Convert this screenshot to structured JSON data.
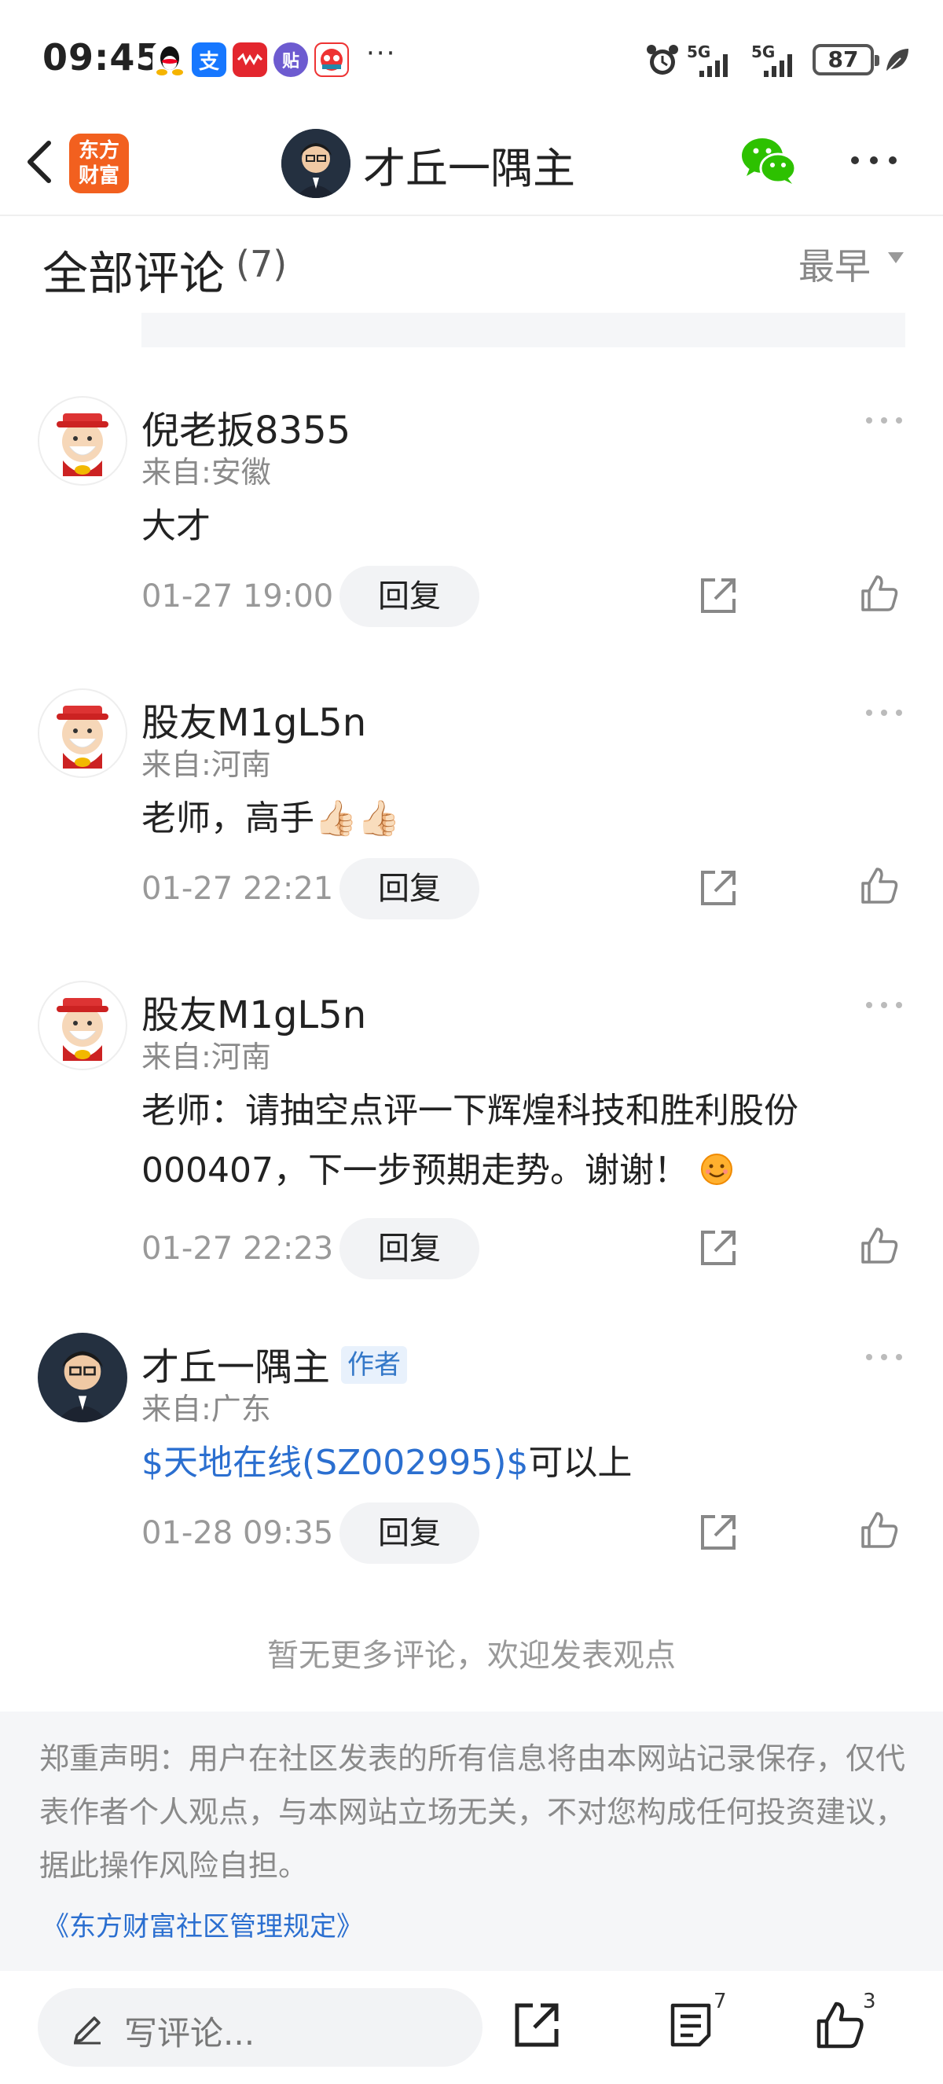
{
  "status_bar": {
    "time": "09:45",
    "app_icons": [
      "qq-icon",
      "alipay-icon",
      "music-icon",
      "tieba-icon",
      "game-icon"
    ],
    "alipay_glyph": "支",
    "tieba_glyph": "贴",
    "more": "···",
    "signal_1": "5G",
    "signal_2": "5G",
    "battery": "87"
  },
  "nav": {
    "brand": "东方财富",
    "brand_line1": "东方",
    "brand_line2": "财富",
    "title": "才丘一隅主"
  },
  "comments_header": {
    "title": "全部评论",
    "count": "(7)",
    "sort": "最早"
  },
  "comments": [
    {
      "name": "倪老扳8355",
      "location": "来自:安徽",
      "text": "大才",
      "time": "01-27 19:00",
      "reply": "回复"
    },
    {
      "name": "股友M1gL5n",
      "location": "来自:河南",
      "text": "老师，高手👍🏻👍🏻",
      "time": "01-27 22:21",
      "reply": "回复"
    },
    {
      "name": "股友M1gL5n",
      "location": "来自:河南",
      "text": "老师：请抽空点评一下辉煌科技和胜利股份000407，下一步预期走势。谢谢！",
      "time": "01-27 22:23",
      "reply": "回复"
    },
    {
      "name": "才丘一隅主",
      "badge": "作者",
      "location": "来自:广东",
      "stock": "$天地在线(SZ002995)$",
      "text": "可以上",
      "time": "01-28 09:35",
      "reply": "回复"
    }
  ],
  "footer": {
    "no_more": "暂无更多评论，欢迎发表观点",
    "disclaimer": "郑重声明：用户在社区发表的所有信息将由本网站记录保存，仅代表作者个人观点，与本网站立场无关，不对您构成任何投资建议，据此操作风险自担。",
    "rules_link": "《东方财富社区管理规定》"
  },
  "bottom_bar": {
    "placeholder": "写评论...",
    "comment_count": "7",
    "like_count": "3"
  },
  "colors": {
    "brand_orange": "#f2601f",
    "link_blue": "#2b6fd0",
    "wechat_green": "#2dc100"
  }
}
